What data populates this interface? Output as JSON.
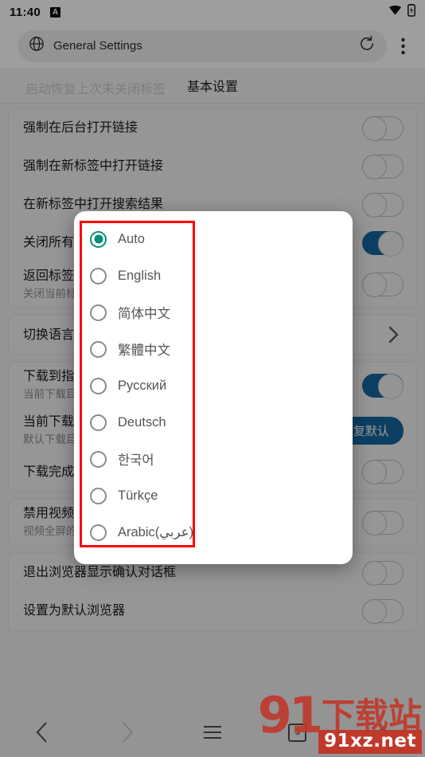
{
  "status_bar": {
    "time": "11:40",
    "app_badge": "A",
    "icons": [
      "wifi-icon",
      "battery-icon"
    ]
  },
  "toolbar": {
    "globe_icon": "globe-icon",
    "page_title": "General Settings",
    "reload_icon": "reload-icon",
    "overflow_icon": "more-vertical-icon"
  },
  "section_header": {
    "title": "基本设置",
    "ghost_text": "启动恢复上次未关闭标签"
  },
  "settings": {
    "groups": [
      {
        "rows": [
          {
            "title": "强制在后台打开链接",
            "sub": "",
            "control": "toggle",
            "value": "off"
          },
          {
            "title": "强制在新标签中打开链接",
            "sub": "",
            "control": "toggle",
            "value": "off"
          },
          {
            "title": "在新标签中打开搜索结果",
            "sub": "",
            "control": "toggle",
            "value": "off"
          },
          {
            "title": "关闭所有标签时退出浏览器",
            "sub": "",
            "control": "toggle",
            "value": "on"
          },
          {
            "title": "返回标签自动关闭",
            "sub": "关闭当前标签后自动返回上一个标签，不退回",
            "control": "toggle",
            "value": "off"
          }
        ]
      },
      {
        "rows": [
          {
            "title": "切换语言",
            "sub": "",
            "control": "chevron",
            "value": ""
          }
        ]
      },
      {
        "rows": [
          {
            "title": "下载到指定目录",
            "sub": "当前下载目录使用自定义路径",
            "control": "toggle",
            "value": "on"
          },
          {
            "title": "当前下载目录",
            "sub": "默认下载目录",
            "control": "button",
            "value": "恢复默认"
          },
          {
            "title": "下载完成后提示",
            "sub": "",
            "control": "toggle",
            "value": "off"
          }
        ]
      },
      {
        "rows": [
          {
            "title": "禁用视频全屏强制横屏",
            "sub": "视频全屏的时候不强制横屏，而是跟随手机方向",
            "control": "toggle",
            "value": "off"
          }
        ]
      },
      {
        "rows": [
          {
            "title": "退出浏览器显示确认对话框",
            "sub": "",
            "control": "toggle",
            "value": "off"
          },
          {
            "title": "设置为默认浏览器",
            "sub": "",
            "control": "toggle",
            "value": "off"
          }
        ]
      }
    ]
  },
  "dialog": {
    "selected": "Auto",
    "accent_color": "#009078",
    "options": [
      {
        "label": "Auto",
        "selected": true
      },
      {
        "label": "English",
        "selected": false
      },
      {
        "label": "简体中文",
        "selected": false
      },
      {
        "label": "繁體中文",
        "selected": false
      },
      {
        "label": "Русский",
        "selected": false
      },
      {
        "label": "Deutsch",
        "selected": false
      },
      {
        "label": "한국어",
        "selected": false
      },
      {
        "label": "Türkçe",
        "selected": false
      },
      {
        "label": "Arabic(عربي)",
        "selected": false
      }
    ]
  },
  "annotation": {
    "color": "#ff0000",
    "shape": "rectangle"
  },
  "bottom_nav": {
    "items": [
      {
        "name": "back-icon",
        "label": ""
      },
      {
        "name": "forward-icon",
        "label": ""
      },
      {
        "name": "menu-icon",
        "label": ""
      },
      {
        "name": "tabs-icon",
        "label": "3"
      },
      {
        "name": "home-icon",
        "label": ""
      }
    ]
  },
  "watermark": {
    "logo_number": "91",
    "logo_text": "下载站",
    "url": "91xz.net"
  }
}
